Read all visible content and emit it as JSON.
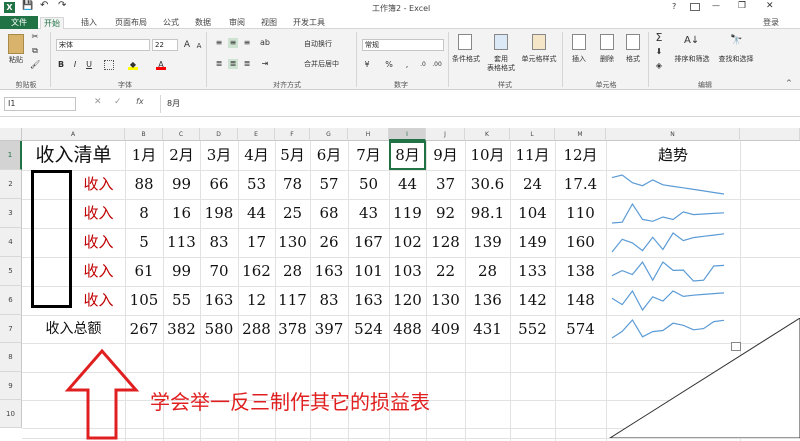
{
  "window": {
    "title": "工作簿2 - Excel",
    "help": "?",
    "minimize": "—",
    "restore": "❐",
    "close": "✕"
  },
  "quick_access": {
    "save": "💾",
    "undo": "↶",
    "redo": "↷"
  },
  "tabs": {
    "file": "文件",
    "home": "开始",
    "insert": "插入",
    "layout": "页面布局",
    "formulas": "公式",
    "data": "数据",
    "review": "审阅",
    "view": "视图",
    "developer": "开发工具",
    "login": "登录"
  },
  "ribbon": {
    "clipboard": {
      "paste": "粘贴",
      "label": "剪贴板"
    },
    "font": {
      "name": "宋体",
      "size": "22",
      "label": "字体",
      "bold": "B",
      "italic": "I",
      "underline": "U",
      "grow": "A",
      "shrink": "A"
    },
    "align": {
      "wrap": "自动换行",
      "merge": "合并后居中",
      "label": "对齐方式"
    },
    "number": {
      "format": "常规",
      "label": "数字",
      "percent": "%",
      "comma": ","
    },
    "styles": {
      "cond": "条件格式",
      "table": "套用",
      "table2": "表格格式",
      "cell": "单元格样式",
      "label": "样式"
    },
    "cells": {
      "insert": "插入",
      "delete": "删除",
      "format": "格式",
      "label": "单元格"
    },
    "editing": {
      "sort": "排序和筛选",
      "find": "查找和选择",
      "label": "编辑",
      "sum": "Σ"
    }
  },
  "formula_bar": {
    "name_box": "I1",
    "fx": "fx",
    "content": "8月"
  },
  "columns": [
    "A",
    "B",
    "C",
    "D",
    "E",
    "F",
    "G",
    "H",
    "I",
    "J",
    "K",
    "L",
    "M",
    "N"
  ],
  "rows": [
    "1",
    "2",
    "3",
    "4",
    "5",
    "6",
    "7",
    "8",
    "9",
    "10"
  ],
  "table": {
    "title": "收入清单",
    "trend_header": "趋势",
    "months": [
      "1月",
      "2月",
      "3月",
      "4月",
      "5月",
      "6月",
      "7月",
      "8月",
      "9月",
      "10月",
      "11月",
      "12月"
    ],
    "label": "收入",
    "data": [
      [
        "88",
        "99",
        "66",
        "53",
        "78",
        "57",
        "50",
        "44",
        "37",
        "30.6",
        "24",
        "17.4"
      ],
      [
        "8",
        "16",
        "198",
        "44",
        "25",
        "68",
        "43",
        "119",
        "92",
        "98.1",
        "104",
        "110"
      ],
      [
        "5",
        "113",
        "83",
        "17",
        "130",
        "26",
        "167",
        "102",
        "128",
        "139",
        "149",
        "160"
      ],
      [
        "61",
        "99",
        "70",
        "162",
        "28",
        "163",
        "101",
        "103",
        "22",
        "28",
        "133",
        "138"
      ],
      [
        "105",
        "55",
        "163",
        "12",
        "117",
        "83",
        "163",
        "120",
        "130",
        "136",
        "142",
        "148"
      ]
    ],
    "total_label": "收入总额",
    "totals": [
      "267",
      "382",
      "580",
      "288",
      "378",
      "397",
      "524",
      "488",
      "409",
      "431",
      "552",
      "574"
    ]
  },
  "sparkline_series": [
    [
      88,
      99,
      66,
      53,
      78,
      57,
      50,
      44,
      37,
      30.6,
      24,
      17.4
    ],
    [
      8,
      16,
      198,
      44,
      25,
      68,
      43,
      119,
      92,
      98.1,
      104,
      110
    ],
    [
      5,
      113,
      83,
      17,
      130,
      26,
      167,
      102,
      128,
      139,
      149,
      160
    ],
    [
      61,
      99,
      70,
      162,
      28,
      163,
      101,
      103,
      22,
      28,
      133,
      138
    ],
    [
      105,
      55,
      163,
      12,
      117,
      83,
      163,
      120,
      130,
      136,
      142,
      148
    ],
    [
      267,
      382,
      580,
      288,
      378,
      397,
      524,
      488,
      409,
      431,
      552,
      574
    ]
  ],
  "annotation": {
    "text": "学会举一反三制作其它的损益表"
  },
  "colors": {
    "excel_green": "#217346",
    "red_text": "#c00000",
    "annotation_red": "#e02020",
    "sparkline": "#5b9bd5"
  }
}
